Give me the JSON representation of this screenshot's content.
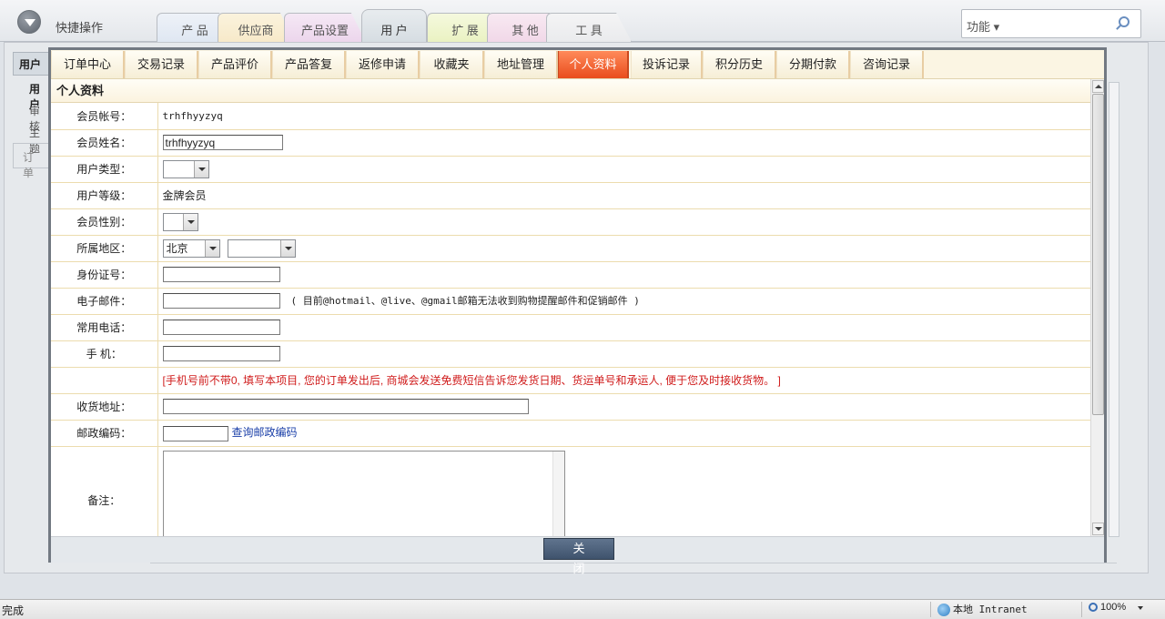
{
  "topbar": {
    "quick_label": "快捷操作",
    "tabs": [
      "产 品",
      "供应商",
      "产品设置",
      "用 户",
      "扩 展",
      "其 他",
      "工 具"
    ],
    "active_tab": "用 户",
    "tab_colors": [
      "#dfe7f2",
      "#f7e9c9",
      "#ecd6ec",
      "#dfe6ea",
      "#eaf2c2",
      "#f1d8e8",
      "#eaebed"
    ],
    "search_select": "功能 ▾"
  },
  "background": {
    "left_tab": "用户",
    "left_items": [
      "用户",
      "审核",
      "主题"
    ],
    "left_bottom": "订单"
  },
  "dialog": {
    "tabs": [
      "订单中心",
      "交易记录",
      "产品评价",
      "产品答复",
      "返修申请",
      "收藏夹",
      "地址管理",
      "个人资料",
      "投诉记录",
      "积分历史",
      "分期付款",
      "咨询记录"
    ],
    "active_tab": "个人资料",
    "active_color": "#ee5a28",
    "section_title": "个人资料",
    "fields": {
      "account_label": "会员帐号：",
      "account_value": "trhfhyyzyq",
      "name_label": "会员姓名：",
      "name_value": "trhfhyyzyq",
      "type_label": "用户类型：",
      "type_value": "",
      "level_label": "用户等级：",
      "level_value": "金牌会员",
      "gender_label": "会员性别：",
      "gender_value": "",
      "region_label": "所属地区：",
      "region_province": "北京",
      "region_city": "",
      "idcard_label": "身份证号：",
      "idcard_value": "",
      "email_label": "电子邮件：",
      "email_value": "",
      "email_note": "( 目前@hotmail、@live、@gmail邮箱无法收到购物提醒邮件和促销邮件 )",
      "phone_label": "常用电话：",
      "phone_value": "",
      "mobile_label": "手 机：",
      "mobile_value": "",
      "mobile_note": "[手机号前不带0, 填写本项目, 您的订单发出后, 商城会发送免费短信告诉您发货日期、货运单号和承运人, 便于您及时接收货物。 ]",
      "address_label": "收货地址：",
      "address_value": "",
      "zip_label": "邮政编码：",
      "zip_value": "",
      "zip_link": "查询邮政编码",
      "remark_label": "备注：",
      "remark_value": ""
    },
    "close_button": "关闭"
  },
  "statusbar": {
    "done": "完成",
    "zone": "本地 Intranet",
    "zoom": "100%"
  }
}
